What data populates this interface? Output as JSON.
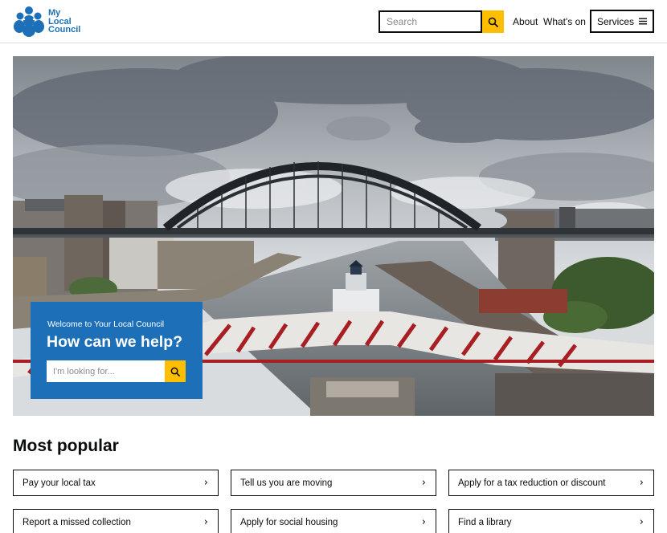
{
  "header": {
    "logo_lines": [
      "My",
      "Local",
      "Council"
    ],
    "search_placeholder": "Search",
    "nav": [
      {
        "label": "About"
      },
      {
        "label": "What's on"
      }
    ],
    "services_label": "Services",
    "colors": {
      "brand": "#1d70b8",
      "accent": "#ffbf00"
    }
  },
  "hero": {
    "welcome": "Welcome to Your Local Council",
    "title": "How can we help?",
    "search_placeholder": "I'm looking for..."
  },
  "popular": {
    "title": "Most popular",
    "items": [
      {
        "label": "Pay your local tax"
      },
      {
        "label": "Tell us you are moving"
      },
      {
        "label": "Apply for a tax reduction or discount"
      },
      {
        "label": "Report a missed collection"
      },
      {
        "label": "Apply for social housing"
      },
      {
        "label": "Find a library"
      }
    ],
    "chevron": "›"
  },
  "icons": {
    "logo": "people-group-icon",
    "search": "search-icon",
    "menu": "hamburger-icon",
    "chevron": "chevron-right-icon"
  }
}
